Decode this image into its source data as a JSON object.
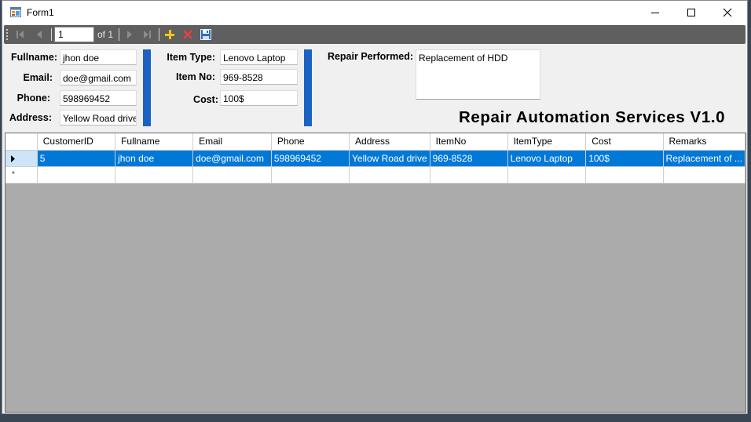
{
  "window": {
    "title": "Form1"
  },
  "navigator": {
    "position": "1",
    "count_label": "of 1"
  },
  "form": {
    "fullname_label": "Fullname:",
    "fullname": "jhon doe",
    "email_label": "Email:",
    "email": "doe@gmail.com",
    "phone_label": "Phone:",
    "phone": "598969452",
    "address_label": "Address:",
    "address": "Yellow Road drive",
    "item_type_label": "Item Type:",
    "item_type": "Lenovo Laptop",
    "item_no_label": "Item No:",
    "item_no": "969-8528",
    "cost_label": "Cost:",
    "cost": "100$",
    "repair_label": "Repair Performed:",
    "repair": "Replacement of HDD"
  },
  "heading": "Repair Automation Services V1.0",
  "grid": {
    "columns": [
      "CustomerID",
      "Fullname",
      "Email",
      "Phone",
      "Address",
      "ItemNo",
      "ItemType",
      "Cost",
      "Remarks"
    ],
    "rows": [
      [
        "5",
        "jhon doe",
        "doe@gmail.com",
        "598969452",
        "Yellow Road drive",
        "969-8528",
        "Lenovo Laptop",
        "100$",
        "Replacement of ..."
      ]
    ],
    "new_row_marker": "*"
  },
  "colors": {
    "accent_bar": "#1a63c4",
    "selection": "#0078d7",
    "toolbar": "#5f5f5f",
    "grid_background": "#ababab"
  },
  "icons": [
    "app-form-icon",
    "move-first-icon",
    "move-previous-icon",
    "move-next-icon",
    "move-last-icon",
    "add-new-icon",
    "delete-icon",
    "save-icon",
    "minimize-icon",
    "maximize-icon",
    "close-icon",
    "current-row-icon"
  ]
}
